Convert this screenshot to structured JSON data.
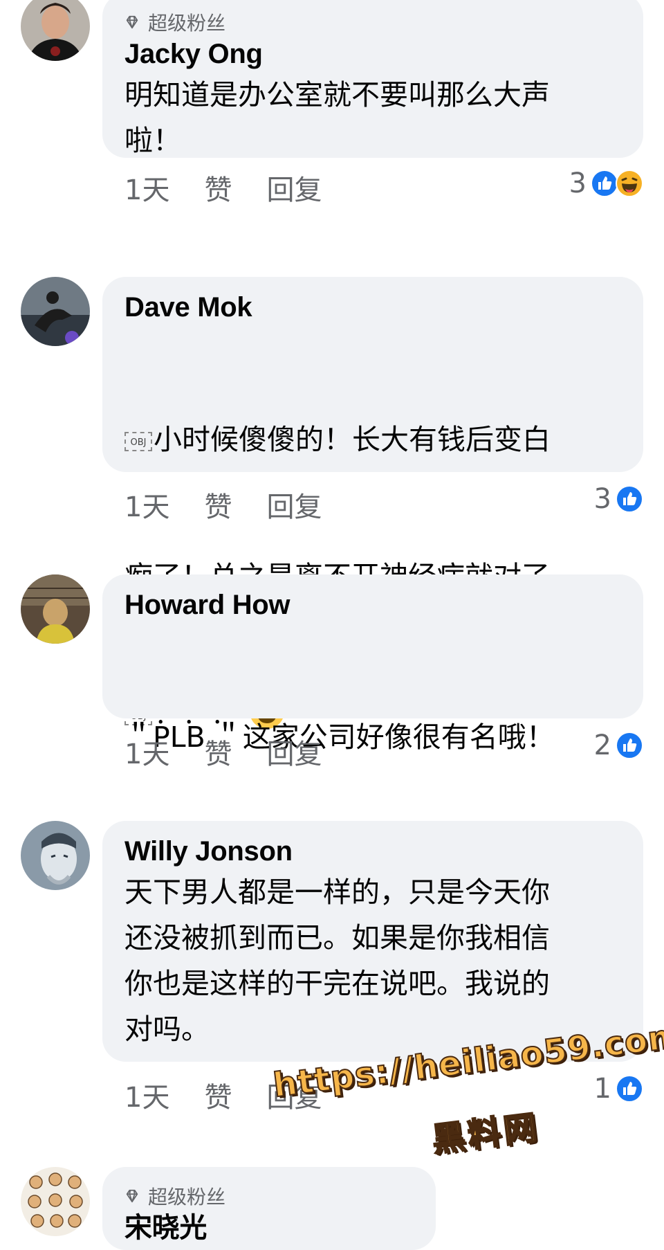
{
  "comments": [
    {
      "badge": "超级粉丝",
      "author": "Jacky Ong",
      "text": "明知道是办公室就不要叫那么大声\n啦！",
      "time": "1天",
      "like": "赞",
      "reply": "回复",
      "reaction_count": "3",
      "reactions": [
        "like-icon",
        "haha-icon"
      ]
    },
    {
      "author": "Dave Mok",
      "text_line1": "小时候傻傻的！长大有钱后变白",
      "text_line2": "痴了！总之是离不开神经病就对了",
      "text_line3": "！！！",
      "obj_placeholder": "OBJ",
      "time": "1天",
      "like": "赞",
      "reply": "回复",
      "reaction_count": "3",
      "reactions": [
        "like-icon"
      ]
    },
    {
      "author": "Howard How",
      "text": "＂PLB ＂这家公司好像很有名哦！",
      "time": "1天",
      "like": "赞",
      "reply": "回复",
      "reaction_count": "2",
      "reactions": [
        "like-icon"
      ]
    },
    {
      "author": "Willy Jonson",
      "text": "天下男人都是一样的，只是今天你\n还没被抓到而已。如果是你我相信\n你也是这样的干完在说吧。我说的\n对吗。",
      "time": "1天",
      "like": "赞",
      "reply": "回复",
      "reaction_count": "1",
      "reactions": [
        "like-icon"
      ]
    },
    {
      "badge": "超级粉丝",
      "author": "宋晓光"
    }
  ],
  "watermark": {
    "url": "https://heiliao59.com",
    "name": "黑料网"
  },
  "colors": {
    "bubble": "#f0f2f5",
    "meta": "#65676b",
    "like_blue": "#1877f2"
  }
}
